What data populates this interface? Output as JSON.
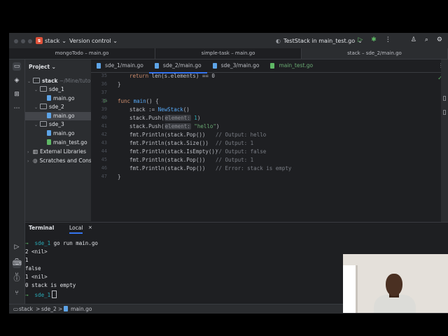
{
  "titlebar": {
    "project_letter": "s",
    "project_name": "stack",
    "version_control": "Version control",
    "run_config": "TestStack in main_test.go"
  },
  "window_tabs": [
    "mongoTodo – main.go",
    "simple-task – main.go",
    "stack – sde_2/main.go"
  ],
  "project_panel": {
    "title": "Project",
    "root": "stack",
    "root_path": "~/Mine/tutoria",
    "items": [
      {
        "label": "sde_1",
        "type": "folder"
      },
      {
        "label": "main.go",
        "type": "go"
      },
      {
        "label": "sde_2",
        "type": "folder"
      },
      {
        "label": "main.go",
        "type": "go"
      },
      {
        "label": "sde_3",
        "type": "folder"
      },
      {
        "label": "main.go",
        "type": "go"
      },
      {
        "label": "main_test.go",
        "type": "test"
      },
      {
        "label": "External Libraries",
        "type": "lib"
      },
      {
        "label": "Scratches and Conso",
        "type": "scratch"
      }
    ]
  },
  "editor": {
    "tabs": [
      "sde_1/main.go",
      "sde_2/main.go",
      "sde_3/main.go",
      "main_test.go"
    ],
    "line_numbers": [
      "35",
      "36",
      "37",
      "38",
      "39",
      "40",
      "41",
      "42",
      "43",
      "44",
      "45",
      "46",
      "47"
    ],
    "lines": {
      "l35_kw": "return",
      "l35_rest": " len(s.elements) == 0",
      "l36": "}",
      "l38_kw": "func",
      "l38_fn": "main",
      "l38_rest": "() {",
      "l39_a": "stack := ",
      "l39_fn": "NewStack",
      "l39_b": "()",
      "push_a": "stack.Push(",
      "hint": "element:",
      "l40_num": " 1",
      "l40_end": ")",
      "l41_str": " \"hello\"",
      "l41_end": ")",
      "l42_code": "fmt.Println(stack.Pop())",
      "l42_cm": "// Output: hello",
      "l43_code": "fmt.Println(stack.Size())",
      "l43_cm": "// Output: 1",
      "l44_code": "fmt.Println(stack.IsEmpty())",
      "l44_cm": "// Output: false",
      "l45_code": "fmt.Println(stack.Pop())",
      "l45_cm": "// Output: 1",
      "l46_code": "fmt.Println(stack.Pop())",
      "l46_cm": "// Error: stack is empty",
      "l47": "}"
    }
  },
  "terminal": {
    "tab_terminal": "Terminal",
    "tab_local": "Local",
    "prompt_symbol": "→",
    "dir": "sde_1",
    "command": "go run main.go",
    "output": [
      "2 <nil>",
      "1",
      "false",
      "1 <nil>",
      "0 stack is empty"
    ]
  },
  "statusbar": {
    "crumbs": [
      "stack",
      "sde_2",
      "main.go"
    ],
    "separator": ">"
  },
  "colors": {
    "background": "#1e1f22",
    "panel": "#2b2d30",
    "accent": "#3574f0",
    "keyword": "#cf8e6d",
    "function": "#56a8f5",
    "string": "#6aab73",
    "comment": "#7a7e85",
    "prompt": "#5fb865"
  }
}
